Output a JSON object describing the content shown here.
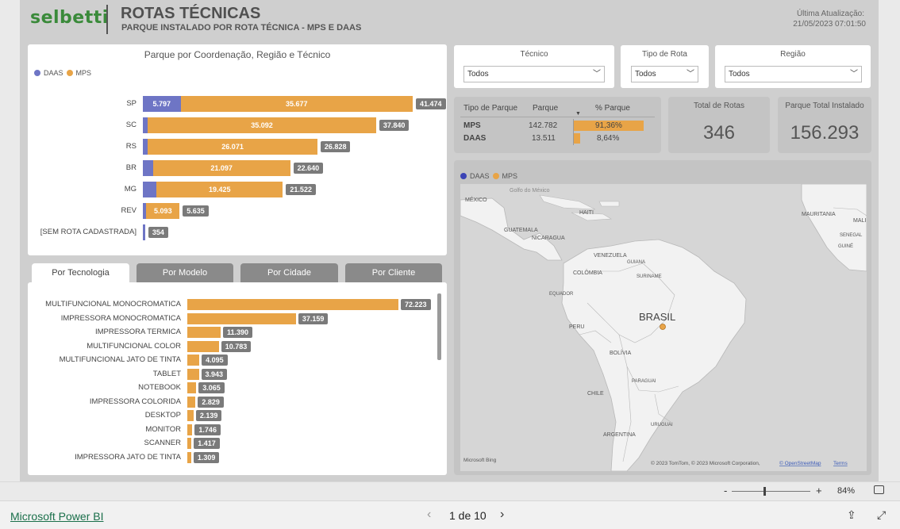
{
  "header": {
    "logo_text": "selbetti",
    "title": "ROTAS TÉCNICAS",
    "subtitle": "PARQUE INSTALADO POR ROTA TÉCNICA - MPS E DAAS",
    "update_label": "Última Atualização:",
    "update_value": "21/05/2023 07:01:50"
  },
  "colors": {
    "daas": "#6e75c5",
    "mps": "#e8a447",
    "total_label": "#7a7a7a",
    "brand_green": "#3a8a3a"
  },
  "chart_data": [
    {
      "type": "bar",
      "orientation": "horizontal-stacked",
      "title": "Parque por Coordenação, Região e Técnico",
      "legend": [
        "DAAS",
        "MPS"
      ],
      "categories": [
        "SP",
        "SC",
        "RS",
        "BR",
        "MG",
        "REV",
        "[SEM ROTA CADASTRADA]"
      ],
      "series": [
        {
          "name": "DAAS",
          "values": [
            5797,
            748,
            757,
            1543,
            2097,
            542,
            354
          ]
        },
        {
          "name": "MPS",
          "values": [
            35677,
            35092,
            26071,
            21097,
            19425,
            5093,
            0
          ]
        }
      ],
      "labels": {
        "daas": [
          "5.797",
          "",
          "",
          "",
          "",
          "",
          ""
        ],
        "mps": [
          "35.677",
          "35.092",
          "26.071",
          "21.097",
          "19.425",
          "5.093",
          ""
        ],
        "totals": [
          "41.474",
          "37.840",
          "26.828",
          "22.640",
          "21.522",
          "5.635",
          "354"
        ]
      },
      "totals": [
        41474,
        37840,
        26828,
        22640,
        21522,
        5635,
        354
      ]
    },
    {
      "type": "bar",
      "orientation": "horizontal",
      "categories": [
        "MULTIFUNCIONAL MONOCROMATICA",
        "IMPRESSORA MONOCROMATICA",
        "IMPRESSORA TERMICA",
        "MULTIFUNCIONAL COLOR",
        "MULTIFUNCIONAL JATO DE TINTA",
        "TABLET",
        "NOTEBOOK",
        "IMPRESSORA COLORIDA",
        "DESKTOP",
        "MONITOR",
        "SCANNER",
        "IMPRESSORA JATO DE TINTA"
      ],
      "values": [
        72223,
        37159,
        11390,
        10783,
        4095,
        3943,
        3065,
        2829,
        2139,
        1746,
        1417,
        1309
      ],
      "value_labels": [
        "72.223",
        "37.159",
        "11.390",
        "10.783",
        "4.095",
        "3.943",
        "3.065",
        "2.829",
        "2.139",
        "1.746",
        "1.417",
        "1.309"
      ]
    }
  ],
  "slicers": [
    {
      "label": "Técnico",
      "value": "Todos"
    },
    {
      "label": "Tipo de Rota",
      "value": "Todos"
    },
    {
      "label": "Região",
      "value": "Todos"
    }
  ],
  "parque_table": {
    "headers": [
      "Tipo de Parque",
      "Parque",
      "% Parque"
    ],
    "rows": [
      {
        "tipo": "MPS",
        "parque": "142.782",
        "pct": "91,36%",
        "pct_value": 91.36
      },
      {
        "tipo": "DAAS",
        "parque": "13.511",
        "pct": "8,64%",
        "pct_value": 8.64
      }
    ]
  },
  "kpis": [
    {
      "label": "Total de Rotas",
      "value": "346"
    },
    {
      "label": "Parque Total Instalado",
      "value": "156.293"
    }
  ],
  "map": {
    "legend": [
      "DAAS",
      "MPS"
    ],
    "labels": [
      "MÉXICO",
      "Golfo do México",
      "HAITI",
      "GUATEMALA",
      "NICARAGUA",
      "VENEZUELA",
      "COLÔMBIA",
      "GUIANA",
      "SURINAME",
      "EQUADOR",
      "PERU",
      "BRASIL",
      "BOLÍVIA",
      "PARAGUAI",
      "CHILE",
      "ARGENTINA",
      "URUGUAI",
      "MAURITANIA",
      "MALI",
      "SENEGAL",
      "GUINÉ"
    ],
    "attribution": "© 2023 TomTom, © 2023 Microsoft Corporation,",
    "osm": "© OpenStreetMap",
    "terms": "Terms",
    "bing": "Microsoft Bing"
  },
  "tabs": [
    {
      "label": "Por Tecnologia",
      "active": true
    },
    {
      "label": "Por Modelo",
      "active": false
    },
    {
      "label": "Por Cidade",
      "active": false
    },
    {
      "label": "Por Cliente",
      "active": false
    }
  ],
  "zoom": {
    "minus": "-",
    "plus": "+",
    "level": "84%"
  },
  "footer": {
    "link": "Microsoft Power BI",
    "page": "1 de 10"
  }
}
